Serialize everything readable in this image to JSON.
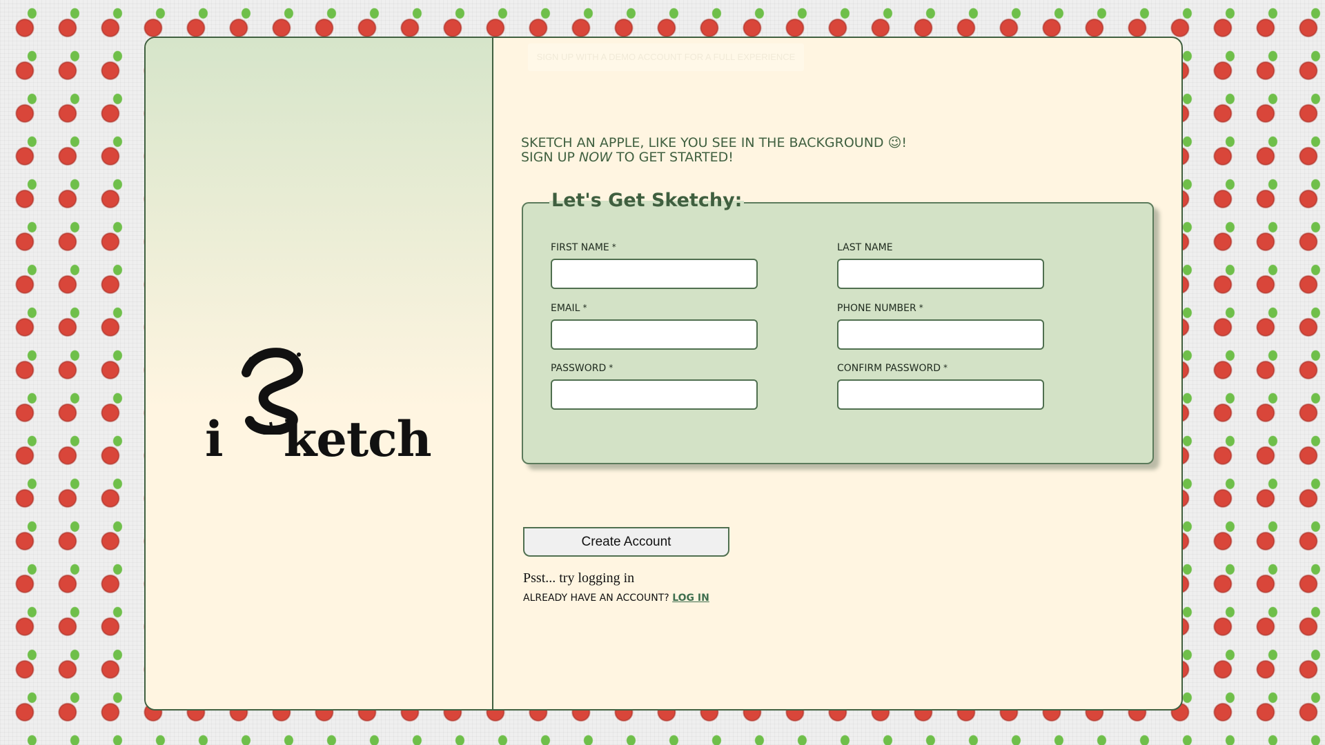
{
  "banner": {
    "text": "SIGN UP WITH A DEMO ACCOUNT FOR A FULL EXPERIENCE"
  },
  "logo": {
    "text_i": "i",
    "text_s": "S",
    "text_rest": "ketch"
  },
  "intro": {
    "line1": "Sketch an apple, like you see in the background 😉!",
    "line2_prefix": "Sign up ",
    "line2_emph": "now",
    "line2_suffix": " to get started!"
  },
  "form": {
    "legend": "Let's Get Sketchy:",
    "fields": {
      "first_name": {
        "label": "First Name",
        "required": "*",
        "value": ""
      },
      "last_name": {
        "label": "Last Name",
        "required": "",
        "value": ""
      },
      "email": {
        "label": "Email",
        "required": "*",
        "value": ""
      },
      "phone": {
        "label": "Phone Number",
        "required": "*",
        "value": ""
      },
      "password": {
        "label": "Password",
        "required": "*",
        "value": ""
      },
      "confirm_password": {
        "label": "Confirm Password",
        "required": "*",
        "value": ""
      }
    },
    "submit_label": "Create Account"
  },
  "footer": {
    "psst": "Psst... try logging in",
    "already": "Already have an account? ",
    "login_link": "Log In"
  },
  "colors": {
    "accent_green": "#3f5f3f",
    "panel_cream": "#fff5e1",
    "form_green": "#d3e2c6"
  }
}
